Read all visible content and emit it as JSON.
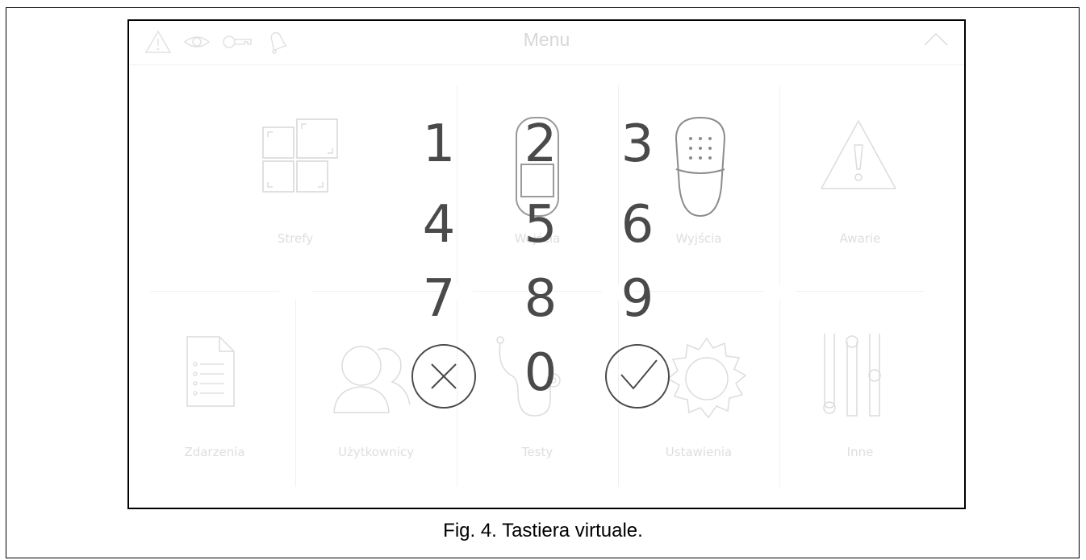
{
  "header": {
    "title": "Menu",
    "status_icons": [
      "warning-icon",
      "eye-icon",
      "key-icon",
      "bell-icon"
    ],
    "collapse_icon": "chevron-up-icon"
  },
  "tiles": [
    {
      "label": "Strefy",
      "icon": "zones-icon"
    },
    {
      "label": "Wejścia",
      "icon": "detector-icon"
    },
    {
      "label": "Wyjścia",
      "icon": "siren-icon"
    },
    {
      "label": "Awarie",
      "icon": "warning-icon"
    },
    {
      "label": "Zdarzenia",
      "icon": "document-icon"
    },
    {
      "label": "Użytkownicy",
      "icon": "users-icon"
    },
    {
      "label": "Testy",
      "icon": "stethoscope-icon"
    },
    {
      "label": "Ustawienia",
      "icon": "gear-icon"
    },
    {
      "label": "Inne",
      "icon": "sliders-icon"
    }
  ],
  "keypad": {
    "keys": [
      "1",
      "2",
      "3",
      "4",
      "5",
      "6",
      "7",
      "8",
      "9",
      "0"
    ],
    "cancel_icon": "cancel-icon",
    "confirm_icon": "confirm-icon"
  },
  "caption": "Fig. 4. Tastiera virtuale."
}
